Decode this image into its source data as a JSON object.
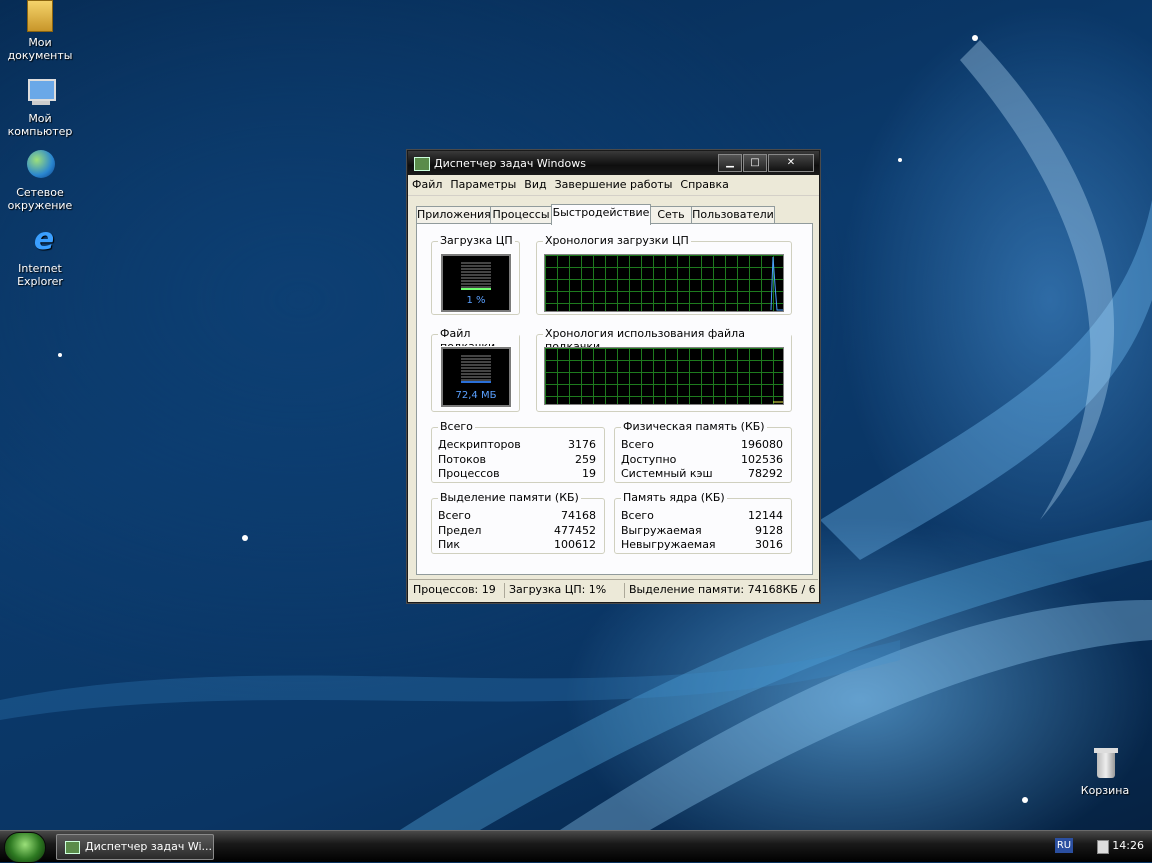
{
  "desktop": {
    "icons": [
      {
        "label": "Мои документы",
        "icon": "my-documents-folder-icon"
      },
      {
        "label": "Мой компьютер",
        "icon": "my-computer-icon"
      },
      {
        "label": "Сетевое окружение",
        "icon": "network-places-icon"
      },
      {
        "label": "Internet Explorer",
        "icon": "internet-explorer-icon"
      },
      {
        "label": "Корзина",
        "icon": "recycle-bin-icon"
      }
    ]
  },
  "window": {
    "title": "Диспетчер задач Windows",
    "controls": {
      "minimize": "▁",
      "maximize": "□",
      "close": "✕"
    },
    "menu": [
      "Файл",
      "Параметры",
      "Вид",
      "Завершение работы",
      "Справка"
    ],
    "tabs": [
      {
        "label": "Приложения"
      },
      {
        "label": "Процессы"
      },
      {
        "label": "Быстродействие",
        "active": true
      },
      {
        "label": "Сеть"
      },
      {
        "label": "Пользователи"
      }
    ],
    "performance": {
      "cpu_usage": {
        "label": "Загрузка ЦП",
        "value_text": "1 %",
        "level": 0.01
      },
      "cpu_history": {
        "label": "Хронология загрузки ЦП"
      },
      "pagefile": {
        "label": "Файл подкачки",
        "value_text": "72,4 МБ",
        "level": 0.07
      },
      "pagefile_history": {
        "label": "Хронология использования файла подкачки"
      },
      "totals": {
        "label": "Всего",
        "rows": [
          {
            "name": "Дескрипторов",
            "value": "3176"
          },
          {
            "name": "Потоков",
            "value": "259"
          },
          {
            "name": "Процессов",
            "value": "19"
          }
        ]
      },
      "physical_memory": {
        "label": "Физическая память (КБ)",
        "rows": [
          {
            "name": "Всего",
            "value": "196080"
          },
          {
            "name": "Доступно",
            "value": "102536"
          },
          {
            "name": "Системный кэш",
            "value": "78292"
          }
        ]
      },
      "commit_charge": {
        "label": "Выделение памяти (КБ)",
        "rows": [
          {
            "name": "Всего",
            "value": "74168"
          },
          {
            "name": "Предел",
            "value": "477452"
          },
          {
            "name": "Пик",
            "value": "100612"
          }
        ]
      },
      "kernel_memory": {
        "label": "Память ядра (КБ)",
        "rows": [
          {
            "name": "Всего",
            "value": "12144"
          },
          {
            "name": "Выгружаемая",
            "value": "9128"
          },
          {
            "name": "Невыгружаемая",
            "value": "3016"
          }
        ]
      }
    },
    "status": {
      "processes": "Процессов: 19",
      "cpu": "Загрузка ЦП: 1%",
      "commit": "Выделение памяти: 74168КБ / 6"
    }
  },
  "taskbar": {
    "task_button": "Диспетчер задач Wi...",
    "language": "RU",
    "clock": "14:26"
  },
  "colors": {
    "graph_grid": "#1e7a1e",
    "meter_text": "#5aa0ff",
    "titlebar": "#1a1a1a"
  }
}
